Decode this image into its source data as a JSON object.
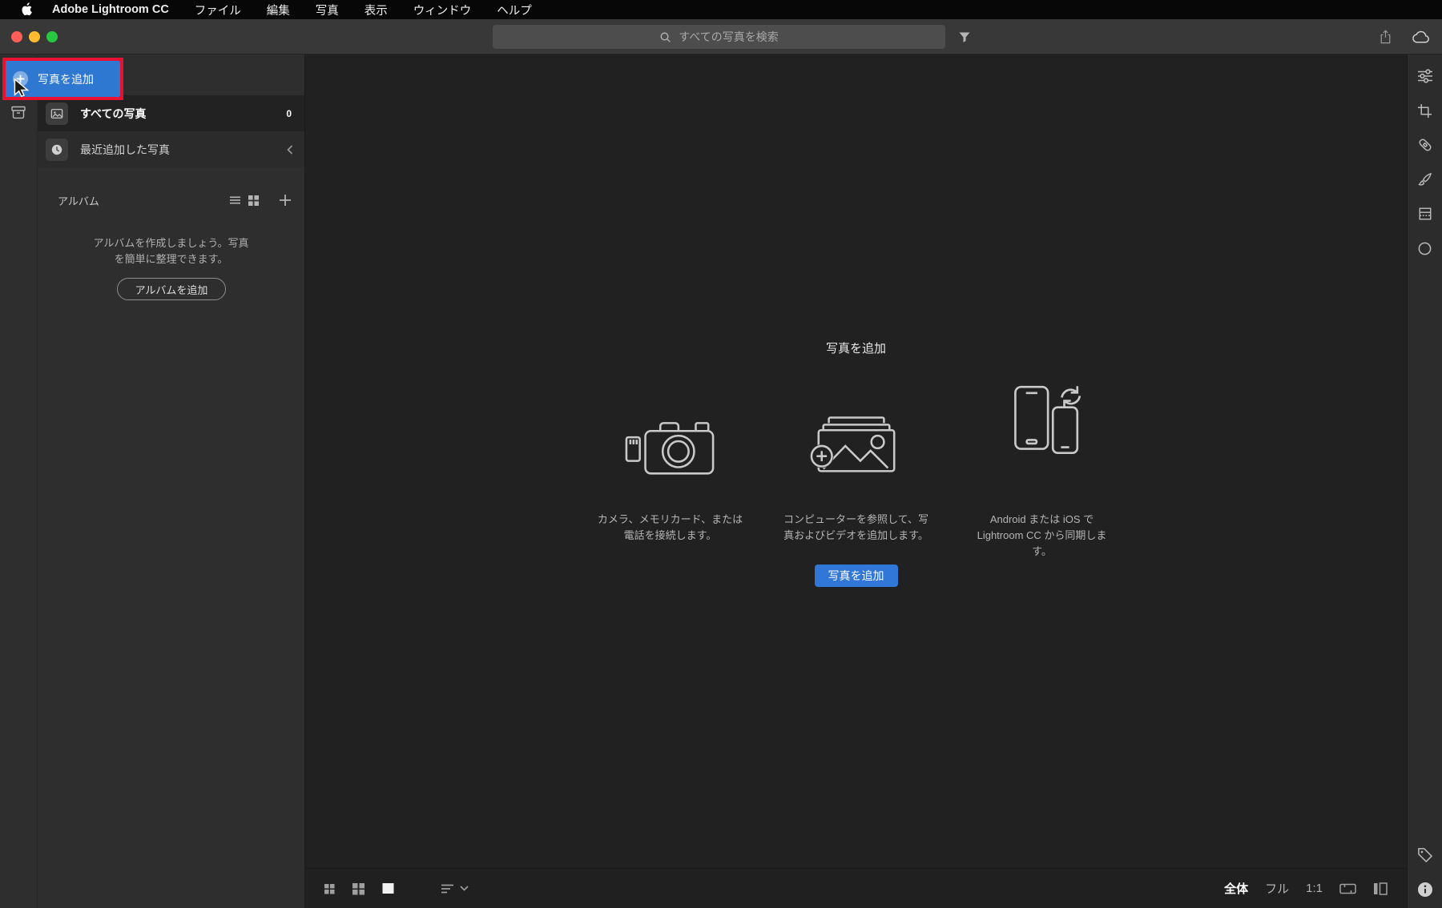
{
  "menu_bar": {
    "app_name": "Adobe Lightroom CC",
    "items": [
      "ファイル",
      "編集",
      "写真",
      "表示",
      "ウィンドウ",
      "ヘルプ"
    ]
  },
  "title_bar": {
    "search_placeholder": "すべての写真を検索"
  },
  "sidebar": {
    "add_photos_label": "写真を追加",
    "all_photos": {
      "label": "すべての写真",
      "count": "0"
    },
    "recently_added": {
      "label": "最近追加した写真"
    },
    "albums": {
      "header": "アルバム",
      "empty_text": "アルバムを作成しましょう。写真\nを簡単に整理できます。",
      "add_button": "アルバムを追加"
    }
  },
  "main": {
    "empty_title": "写真を追加",
    "options": [
      {
        "icon": "camera-sdcard-icon",
        "caption": "カメラ、メモリカード、または\n電話を接続します。"
      },
      {
        "icon": "browse-photos-icon",
        "caption": "コンピューターを参照して、写\n真およびビデオを追加します。"
      },
      {
        "icon": "mobile-sync-icon",
        "caption": "Android または iOS で\nLightroom CC から同期しま\nす。"
      }
    ],
    "add_button": "写真を追加"
  },
  "bottom_bar": {
    "zoom_fit": "全体",
    "zoom_full": "フル",
    "zoom_1_1": "1:1"
  },
  "icons": {
    "menu": "apple-icon",
    "search": "search-icon",
    "filter": "filter-icon",
    "share": "share-icon",
    "cloud": "cloud-sync-icon",
    "right_rail": [
      "edit-sliders-icon",
      "crop-icon",
      "healing-brush-icon",
      "brush-icon",
      "gradient-tool-icon",
      "radial-tool-icon",
      "tag-icon",
      "info-icon"
    ],
    "bottom_bar": [
      "grid-small-icon",
      "grid-large-icon",
      "detail-view-icon",
      "sort-icon",
      "chevron-down-icon",
      "filmstrip-icon",
      "split-view-icon"
    ]
  },
  "colors": {
    "accent_blue": "#3077d8",
    "annotation_red": "#e9112f",
    "titlebar_gray": "#383838",
    "sidebar_gray": "#2e2e2e",
    "main_bg": "#212121"
  }
}
